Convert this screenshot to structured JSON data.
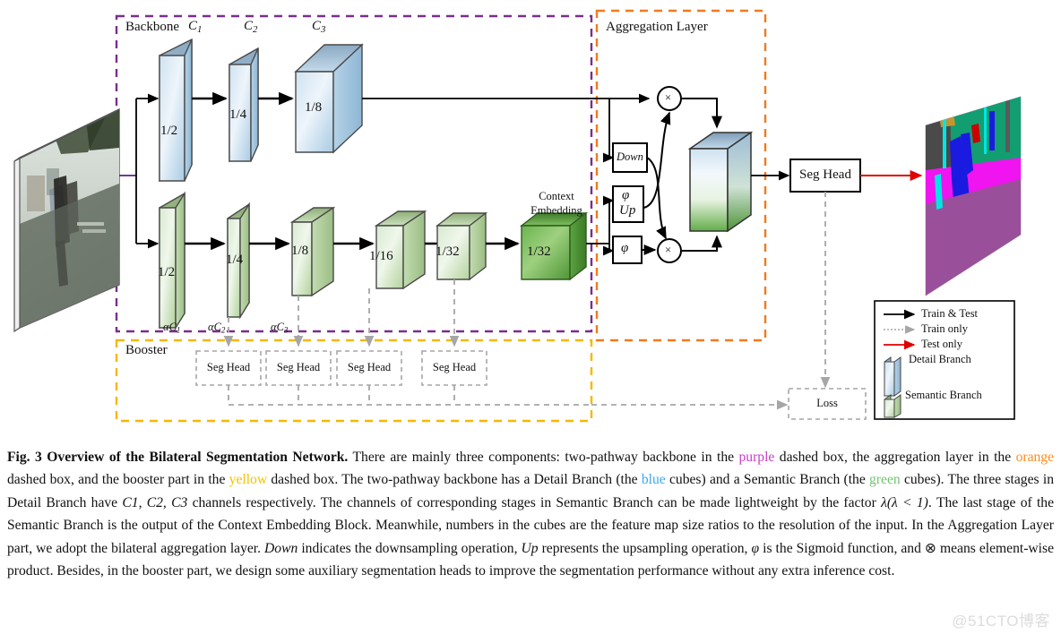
{
  "figure": {
    "sections": {
      "backbone": {
        "label": "Backbone",
        "box_color": "#7B2D8E",
        "style": "dashed"
      },
      "aggregation": {
        "label": "Aggregation Layer",
        "box_color": "#F2791E",
        "style": "dashed"
      },
      "booster": {
        "label": "Booster",
        "box_color": "#F5B800",
        "style": "dashed"
      }
    },
    "input_image": {
      "name": "input-street-scene"
    },
    "output_image": {
      "name": "output-segmentation-map"
    },
    "detail_branch": {
      "name": "Detail Branch",
      "color": "#b9d6ea",
      "channel_labels": [
        "C_1",
        "C_2",
        "C_3"
      ],
      "channel_plain": [
        "C",
        "C",
        "C"
      ],
      "channel_subs": [
        "1",
        "2",
        "3"
      ],
      "ratios": [
        "1/2",
        "1/4",
        "1/8"
      ]
    },
    "semantic_branch": {
      "name": "Semantic Branch",
      "color": "#c6e0b4",
      "channel_labels": [
        "αC_1",
        "αC_2",
        "αC_3"
      ],
      "channel_alpha": "α",
      "channel_plain": [
        "C",
        "C",
        "C"
      ],
      "channel_subs": [
        "1",
        "2",
        "3"
      ],
      "ratios": [
        "1/2",
        "1/4",
        "1/8",
        "1/16",
        "1/32",
        "1/32"
      ],
      "context_embedding_label_line1": "Context",
      "context_embedding_label_line2": "Embedding"
    },
    "aggregation_blocks": {
      "down": "Down",
      "phi_up_line1": "φ",
      "phi_up_line2": "Up",
      "phi": "φ",
      "mult_symbol": "×"
    },
    "seg_head_main": "Seg Head",
    "booster_heads": [
      "Seg Head",
      "Seg Head",
      "Seg Head",
      "Seg Head"
    ],
    "loss_box": "Loss",
    "legend": {
      "items": [
        {
          "label": "Train & Test",
          "kind": "arrow",
          "color": "#000000",
          "dash": "solid"
        },
        {
          "label": "Train only",
          "kind": "arrow",
          "color": "#999999",
          "dash": "dotted"
        },
        {
          "label": "Test only",
          "kind": "arrow",
          "color": "#e00000",
          "dash": "solid"
        },
        {
          "label": "Detail Branch",
          "kind": "cube",
          "color": "#b9d6ea"
        },
        {
          "label": "Semantic Branch",
          "kind": "cube",
          "color": "#c6e0b4"
        }
      ]
    }
  },
  "caption": {
    "fig_label": "Fig. 3",
    "title": "Overview of the Bilateral Segmentation Network.",
    "part1": " There are mainly three components: two-pathway backbone in the ",
    "w_purple": "purple",
    "part2": " dashed box, the aggregation layer in the ",
    "w_orange": "orange",
    "part3": " dashed box, and the booster part in the ",
    "w_yellow": "yellow",
    "part4": " dashed box. The two-pathway backbone has a Detail Branch (the ",
    "w_blue": "blue",
    "part5": " cubes) and a Semantic Branch (the ",
    "w_green": "green",
    "part6": " cubes). The three stages in Detail Branch have ",
    "chans": "C1, C2, C3",
    "part7": " channels respectively. The channels of corresponding stages in Semantic Branch can be made lightweight by the factor ",
    "lambda_expr": "λ(λ < 1)",
    "part8": ". The last stage of the Semantic Branch is the output of the Context Embedding Block. Meanwhile, numbers in the cubes are the feature map size ratios to the resolution of the input. In the Aggregation Layer part, we adopt the bilateral aggregation layer. ",
    "w_down": "Down",
    "part9": " indicates the downsampling operation, ",
    "w_up": "Up",
    "part10": " represents the upsampling operation, ",
    "w_phi": "φ",
    "part11": " is the Sigmoid function, and ",
    "w_otimes": "⊗",
    "part12": " means element-wise product. Besides, in the booster part, we design some auxiliary segmentation heads to improve the segmentation performance without any extra inference cost."
  },
  "watermark": "@51CTO博客"
}
